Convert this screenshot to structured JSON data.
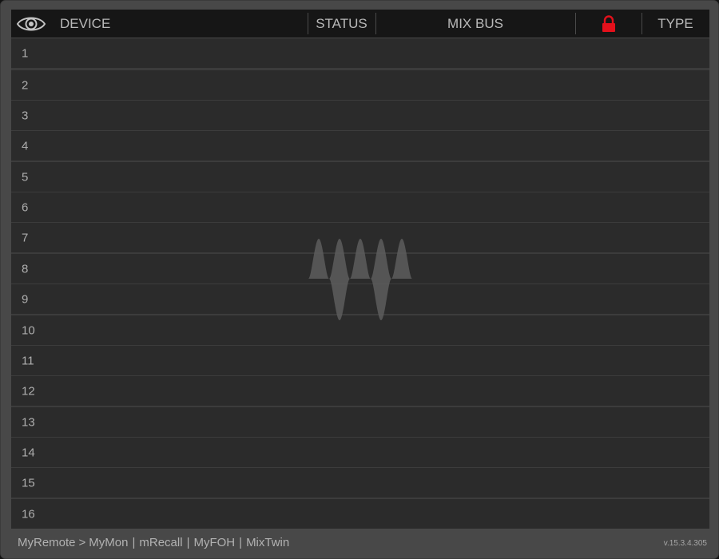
{
  "header": {
    "eye_icon": "eye-icon",
    "device": "DEVICE",
    "status": "STATUS",
    "mix_bus": "MIX BUS",
    "lock_icon": "lock-icon",
    "lock_color": "#e3101b",
    "type": "TYPE"
  },
  "rows": [
    "1",
    "2",
    "3",
    "4",
    "5",
    "6",
    "7",
    "8",
    "9",
    "10",
    "11",
    "12",
    "13",
    "14",
    "15",
    "16"
  ],
  "watermark_icon": "waves-logo-icon",
  "footer": {
    "nav": [
      "MyRemote",
      "MyMon",
      "mRecall",
      "MyFOH",
      "MixTwin"
    ],
    "separator": ">",
    "divider": "|",
    "version": "v.15.3.4.305"
  }
}
